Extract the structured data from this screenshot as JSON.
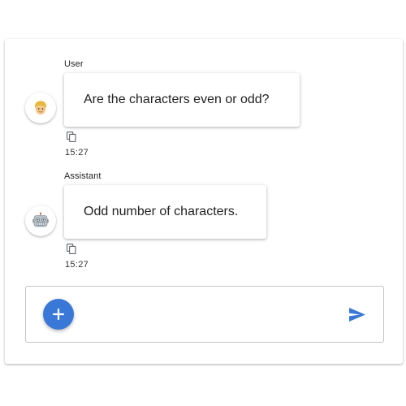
{
  "messages": [
    {
      "sender": "User",
      "avatar_icon": "person-emoji-icon",
      "text": "Are the characters even or odd?",
      "time": "15:27"
    },
    {
      "sender": "Assistant",
      "avatar_icon": "robot-emoji-icon",
      "text": "Odd number of characters.",
      "time": "15:27"
    }
  ],
  "composer": {
    "placeholder": "",
    "value": "",
    "add_icon": "plus-icon",
    "send_icon": "send-icon"
  },
  "colors": {
    "accent": "#3a78d8",
    "send": "#3a78d8"
  }
}
